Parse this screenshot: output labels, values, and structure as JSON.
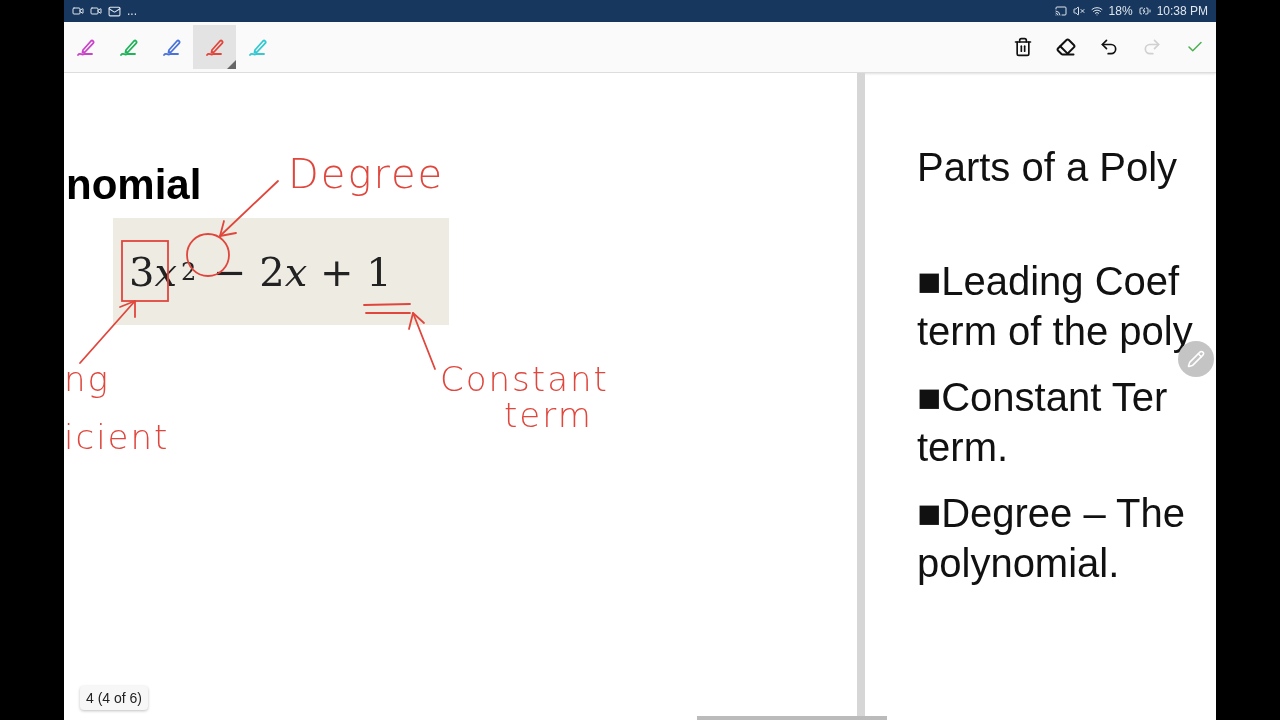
{
  "status_bar": {
    "more": "...",
    "battery": "18%",
    "time": "10:38 PM"
  },
  "toolbar": {
    "pens": [
      {
        "color": "#c944c9",
        "selected": false
      },
      {
        "color": "#1fb35a",
        "selected": false
      },
      {
        "color": "#4a72d9",
        "selected": false
      },
      {
        "color": "#e0463c",
        "selected": true
      },
      {
        "color": "#34c8d0",
        "selected": false
      }
    ],
    "actions": [
      {
        "kind": "delete",
        "disabled": false
      },
      {
        "kind": "eraser",
        "disabled": false
      },
      {
        "kind": "undo",
        "disabled": false
      },
      {
        "kind": "redo",
        "disabled": true
      },
      {
        "kind": "done",
        "disabled": false
      }
    ]
  },
  "left_slide": {
    "title": "nomial",
    "equation": [
      {
        "text": "3",
        "kind": "plain"
      },
      {
        "text": "x",
        "kind": "var"
      },
      {
        "text": "2",
        "kind": "sup"
      },
      {
        "text": " − 2",
        "kind": "plain"
      },
      {
        "text": "x",
        "kind": "var"
      },
      {
        "text": " + 1",
        "kind": "plain"
      }
    ],
    "annotations": [
      "Degree",
      "ng",
      "icient",
      "Constant",
      "term"
    ]
  },
  "right_slide": {
    "title": "Parts of a Poly",
    "bullets": [
      {
        "marker": "■",
        "lines": [
          "Leading Coef",
          "term of the poly"
        ]
      },
      {
        "marker": "■",
        "lines": [
          "Constant Ter",
          "term."
        ]
      },
      {
        "marker": "■",
        "lines": [
          "Degree – The",
          "polynomial."
        ]
      }
    ]
  },
  "page_indicator": "4 (4 of 6)"
}
